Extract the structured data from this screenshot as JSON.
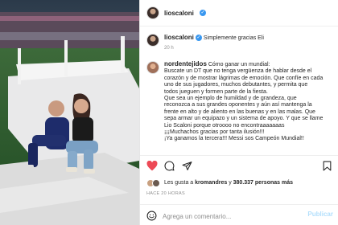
{
  "header": {
    "username": "lioscaloni"
  },
  "caption": {
    "username": "lioscaloni",
    "text": "Simplemente gracias Eli",
    "time": "20 h"
  },
  "comment": {
    "username": "nordentejidos",
    "lines": [
      "Cómo ganar un mundial:",
      "Buscate un DT que no tenga vergüenza de hablar desde el",
      "corazón y de mostrar lágrimas de emoción. Que confíe en cada",
      "uno de sus jugadores, muchos debutantes, y permita que",
      "todos jueguen y formen parte de la fiesta.",
      "Que sea un ejemplo de humildad y de grandeza, que",
      "reconozca a sus grandes oponentes y aún así mantenga la",
      "frente en alto y de aliento en las buenas y en las malas. Que",
      "sepa armar un equipazo y un sistema de apoyo. Y que se llame",
      "Lio Scaloni porque otroooo no encontraaaaaaas",
      "¡¡¡Muchachos gracias por tanta ilusión!!!",
      "¡Ya ganamos la tercera!!! Messi sos Campeón Mundial!!"
    ]
  },
  "likes": {
    "prefix": "Les gusta a",
    "user": "kromandres",
    "middle": "y",
    "count": "380.337",
    "suffix": "personas más"
  },
  "posted": "HACE 20 HORAS",
  "composer": {
    "placeholder": "Agrega un comentario...",
    "publish_label": "Publicar"
  },
  "colors": {
    "verified": "#3897f0",
    "like_heart": "#ed4956"
  }
}
